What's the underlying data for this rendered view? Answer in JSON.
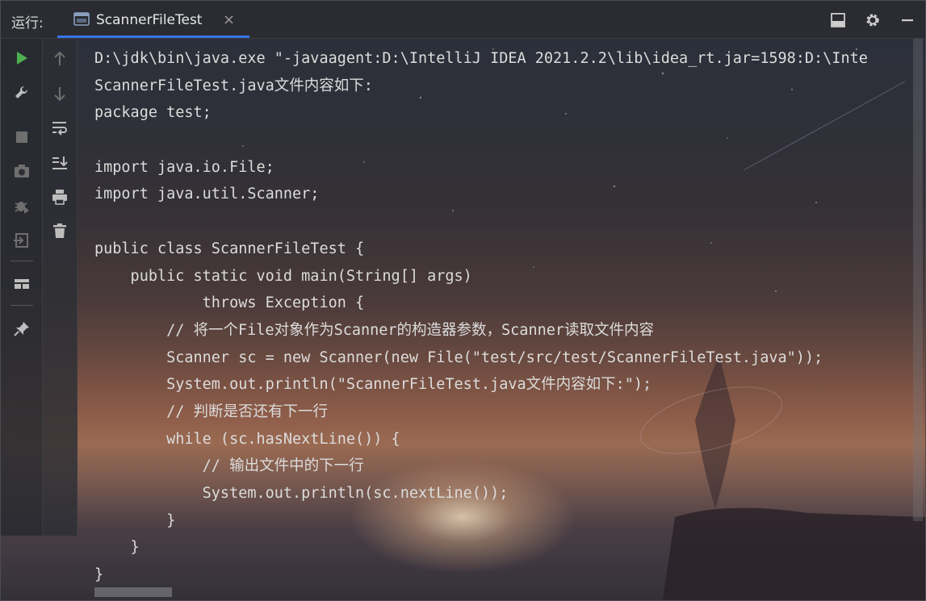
{
  "run_panel": {
    "label": "运行:",
    "tab": {
      "title": "ScannerFileTest",
      "icon": "console-icon"
    }
  },
  "toolbar_top_right": [
    {
      "name": "layout-icon"
    },
    {
      "name": "gear-icon"
    },
    {
      "name": "minimize-icon"
    }
  ],
  "left_toolbar": [
    {
      "name": "rerun-icon"
    },
    {
      "name": "wrench-icon"
    },
    {
      "name": "stop-icon"
    },
    {
      "name": "camera-icon"
    },
    {
      "name": "debug-bug-icon"
    },
    {
      "name": "exit-icon"
    },
    {
      "name": "layout-tiles-icon"
    },
    {
      "name": "pin-icon"
    }
  ],
  "second_toolbar": [
    {
      "name": "arrow-up-icon"
    },
    {
      "name": "arrow-down-icon"
    },
    {
      "name": "soft-wrap-icon"
    },
    {
      "name": "scroll-to-end-icon"
    },
    {
      "name": "print-icon"
    },
    {
      "name": "trash-icon"
    }
  ],
  "console": {
    "lines": [
      "D:\\jdk\\bin\\java.exe \"-javaagent:D:\\IntelliJ IDEA 2021.2.2\\lib\\idea_rt.jar=1598:D:\\Inte",
      "ScannerFileTest.java文件内容如下:",
      "package test;",
      "",
      "import java.io.File;",
      "import java.util.Scanner;",
      "",
      "public class ScannerFileTest {",
      "    public static void main(String[] args)",
      "            throws Exception {",
      "        // 将一个File对象作为Scanner的构造器参数，Scanner读取文件内容",
      "        Scanner sc = new Scanner(new File(\"test/src/test/ScannerFileTest.java\"));",
      "        System.out.println(\"ScannerFileTest.java文件内容如下:\");",
      "        // 判断是否还有下一行",
      "        while (sc.hasNextLine()) {",
      "            // 输出文件中的下一行",
      "            System.out.println(sc.nextLine());",
      "        }",
      "    }",
      "}"
    ]
  },
  "colors": {
    "accent": "#3574f0",
    "run_green": "#4caf50",
    "text": "#dcdcdc"
  }
}
